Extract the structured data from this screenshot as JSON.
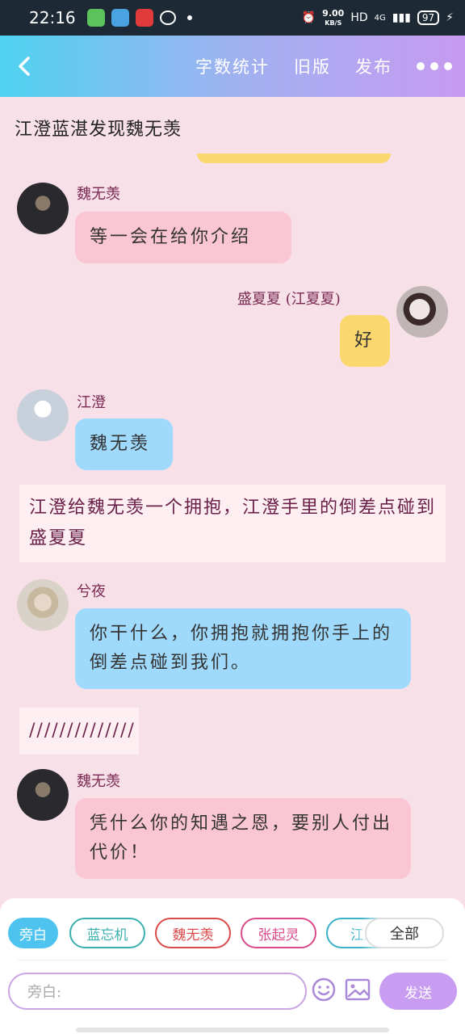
{
  "status_bar": {
    "time": "22:16",
    "speed_value": "9.00",
    "speed_unit": "KB/S",
    "network": "HD",
    "signal": "4G",
    "battery": "97"
  },
  "header": {
    "back_icon": "chevron-left-icon",
    "word_count_label": "字数统计",
    "old_version_label": "旧版",
    "publish_label": "发布",
    "more_icon": "more-dots-icon"
  },
  "content": {
    "page_title": "江澄蓝湛发现魏无羡",
    "messages": [
      {
        "sender": "魏无羡",
        "text": "等一会在给你介绍",
        "side": "left"
      },
      {
        "sender": "盛夏夏 (江夏夏)",
        "text": "好",
        "side": "right"
      },
      {
        "sender": "江澄",
        "text": "魏无羡",
        "side": "left"
      },
      {
        "narration": "江澄给魏无羡一个拥抱，江澄手里的倒差点碰到盛夏夏"
      },
      {
        "sender": "兮夜",
        "text": "你干什么，你拥抱就拥抱你手上的倒差点碰到我们。",
        "side": "left"
      },
      {
        "narration": "//////////////"
      },
      {
        "sender": "魏无羡",
        "text": "凭什么你的知遇之恩，要别人付出代价！",
        "side": "left"
      }
    ]
  },
  "bottom": {
    "chips": [
      "旁白",
      "蓝忘机",
      "魏无羡",
      "张起灵",
      "江厌"
    ],
    "chip_colors": [
      "#4fc3f0",
      "#3ab0b0",
      "#d94a4a",
      "#d94a8a",
      "#3ab0c8"
    ],
    "all_chip": "全部",
    "input_placeholder": "旁白:",
    "emoji_icon": "smiley-icon",
    "image_icon": "image-icon",
    "send_label": "发送"
  }
}
